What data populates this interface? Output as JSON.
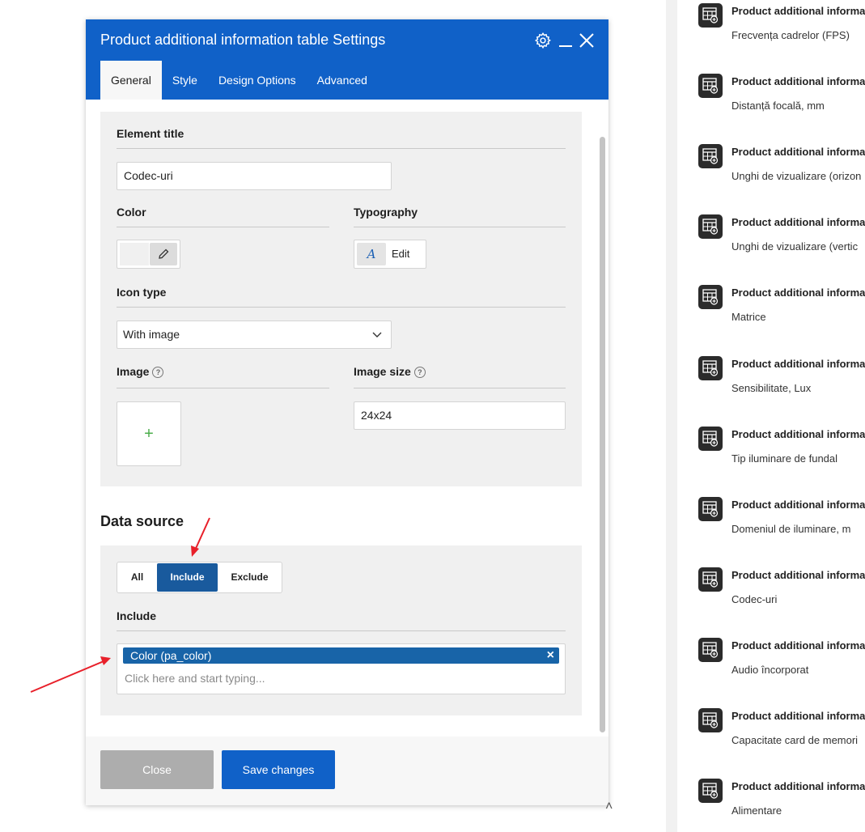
{
  "modal": {
    "title": "Product additional information table Settings",
    "tabs": [
      {
        "label": "General",
        "active": true
      },
      {
        "label": "Style",
        "active": false
      },
      {
        "label": "Design Options",
        "active": false
      },
      {
        "label": "Advanced",
        "active": false
      }
    ],
    "header_icons": [
      "gear-icon",
      "minimize-icon",
      "close-icon"
    ],
    "colors": {
      "header": "#1061c8",
      "accent": "#195a9d",
      "tag": "#1864a8"
    }
  },
  "general": {
    "element_title_label": "Element title",
    "element_title_value": "Codec-uri",
    "color_label": "Color",
    "typography_label": "Typography",
    "typography_edit": "Edit",
    "icon_type_label": "Icon type",
    "icon_type_value": "With image",
    "image_label": "Image",
    "image_add": "+",
    "image_size_label": "Image size",
    "image_size_value": "24x24",
    "help_glyph": "?"
  },
  "data_source": {
    "heading": "Data source",
    "segments": [
      "All",
      "Include",
      "Exclude"
    ],
    "selected": "Include",
    "include_label": "Include",
    "tag": "Color (pa_color)",
    "tag_remove": "×",
    "placeholder": "Click here and start typing..."
  },
  "footer": {
    "close_label": "Close",
    "save_label": "Save changes"
  },
  "sidebar": {
    "items": [
      {
        "title": "Product additional informa",
        "subtitle": "Frecvența cadrelor (FPS)"
      },
      {
        "title": "Product additional informa",
        "subtitle": "Distanță focală, mm"
      },
      {
        "title": "Product additional informa",
        "subtitle": "Unghi de vizualizare (orizon"
      },
      {
        "title": "Product additional informa",
        "subtitle": "Unghi de vizualizare (vertic"
      },
      {
        "title": "Product additional informa",
        "subtitle": "Matrice"
      },
      {
        "title": "Product additional informa",
        "subtitle": "Sensibilitate, Lux"
      },
      {
        "title": "Product additional informa",
        "subtitle": "Tip iluminare de fundal"
      },
      {
        "title": "Product additional informa",
        "subtitle": "Domeniul de iluminare, m"
      },
      {
        "title": "Product additional informa",
        "subtitle": "Codec-uri"
      },
      {
        "title": "Product additional informa",
        "subtitle": "Audio încorporat"
      },
      {
        "title": "Product additional informa",
        "subtitle": "Capacitate card de memori"
      },
      {
        "title": "Product additional informa",
        "subtitle": "Alimentare"
      }
    ]
  },
  "page": {
    "caret": "˄"
  }
}
